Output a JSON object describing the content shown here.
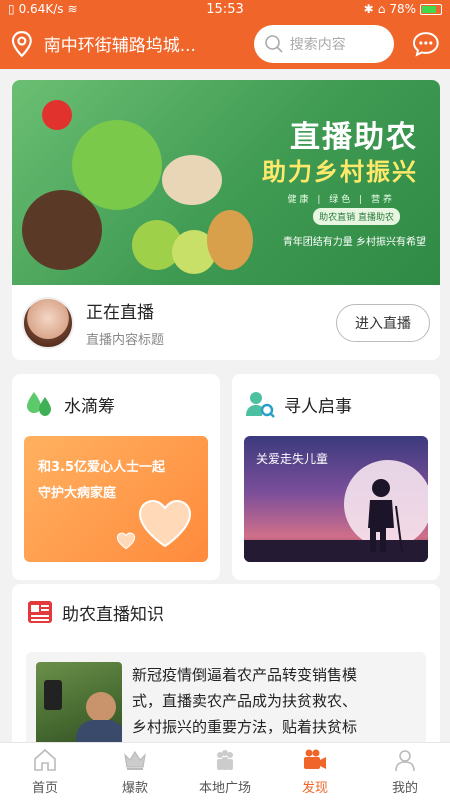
{
  "status_bar": {
    "speed": "0.64K/s",
    "time": "15:53",
    "battery": "78%",
    "battery_level": 0.78
  },
  "header": {
    "location": "南中环街辅路坞城...",
    "search_placeholder": "搜索内容",
    "location_icon": "location-pin-icon",
    "message_icon": "message-icon"
  },
  "live": {
    "banner_title": "直播助农",
    "banner_subtitle": "助力乡村振兴",
    "banner_tags": "健康 | 绿色 | 营养",
    "banner_badge": "助农直销 直播助农",
    "banner_slogan": "青年团结有力量  乡村振兴有希望",
    "status_title": "正在直播",
    "content_title": "直播内容标题",
    "enter_button": "进入直播"
  },
  "water_card": {
    "title": "水滴筹",
    "line1": "和3.5亿爱心人士一起",
    "line2": "守护大病家庭"
  },
  "find_card": {
    "title": "寻人启事",
    "caption": "关爱走失儿童"
  },
  "knowledge": {
    "title": "助农直播知识",
    "article_line1": "新冠疫情倒逼着农产品转变销售模",
    "article_line2": "式，直播卖农产品成为扶贫救农、",
    "article_line3": "乡村振兴的重要方法，贴着扶贫标"
  },
  "tabs": [
    {
      "label": "首页",
      "icon": "home-icon"
    },
    {
      "label": "爆款",
      "icon": "crown-icon"
    },
    {
      "label": "本地广场",
      "icon": "people-icon"
    },
    {
      "label": "发现",
      "icon": "video-camera-icon"
    },
    {
      "label": "我的",
      "icon": "profile-icon"
    }
  ],
  "colors": {
    "brand": "#f0652a",
    "banner_green": "#3f9a52",
    "water_orange": "#ff8a3c"
  }
}
